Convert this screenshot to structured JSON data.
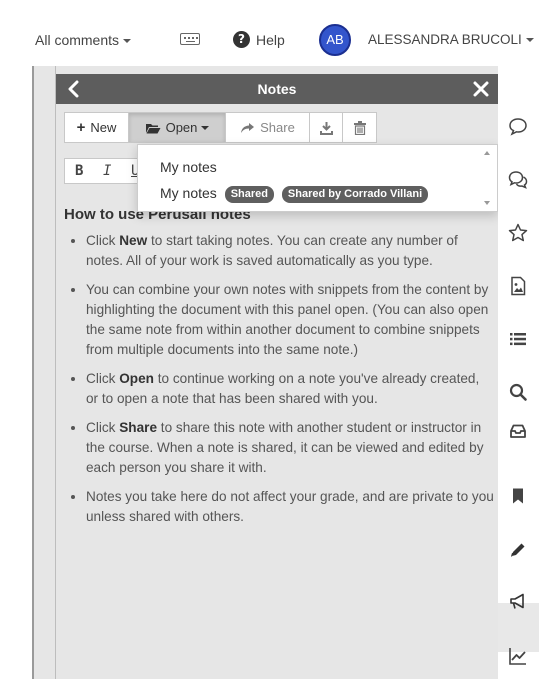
{
  "topbar": {
    "comments_filter": "All comments",
    "help_label": "Help",
    "avatar_initials": "AB",
    "user_name": "ALESSANDRA BRUCOLI"
  },
  "notes": {
    "title": "Notes",
    "toolbar": {
      "new_label": "New",
      "open_label": "Open",
      "share_label": "Share"
    },
    "format": {
      "bold": "B",
      "italic": "I"
    },
    "dropdown": {
      "item1": "My notes",
      "item2": "My notes",
      "badge_shared": "Shared",
      "badge_shared_by": "Shared by Corrado Villani"
    },
    "help": {
      "heading": "How to use Perusall notes",
      "b1_pre": "Click ",
      "b1_bold": "New",
      "b1_post": " to start taking notes. You can create any number of notes. All of your work is saved automatically as you type.",
      "b2": "You can combine your own notes with snippets from the content by highlighting the document with this panel open. (You can also open the same note from within another document to combine snippets from multiple documents into the same note.)",
      "b3_pre": "Click ",
      "b3_bold": "Open",
      "b3_post": " to continue working on a note you've already created, or to open a note that has been shared with you.",
      "b4_pre": "Click ",
      "b4_bold": "Share",
      "b4_post": " to share this note with another student or instructor in the course. When a note is shared, it can be viewed and edited by each person you share it with.",
      "b5": "Notes you take here do not affect your grade, and are private to you unless shared with others."
    }
  },
  "sidebar_icons": [
    "comment-icon",
    "conversations-icon",
    "star-icon",
    "document-image-icon",
    "list-icon",
    "search-icon",
    "inbox-icon",
    "bookmark-icon",
    "pencil-icon",
    "megaphone-icon",
    "chart-icon"
  ],
  "colors": {
    "panel_header": "#5d5d5d",
    "panel_bg": "#e6e6e6",
    "avatar_bg": "#3355cc",
    "badge_bg": "#5f5f5f"
  }
}
